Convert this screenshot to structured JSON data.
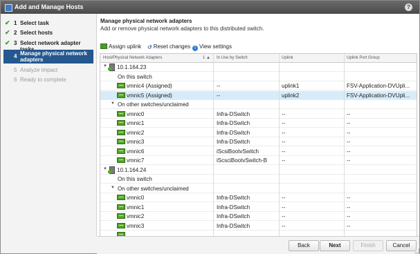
{
  "window": {
    "title": "Add and Manage Hosts",
    "help_label": "?"
  },
  "steps": [
    {
      "num": "1",
      "label": "Select task",
      "state": "done",
      "check": "✔"
    },
    {
      "num": "2",
      "label": "Select hosts",
      "state": "done",
      "check": "✔"
    },
    {
      "num": "3",
      "label": "Select network adapter tasks",
      "state": "done",
      "check": "✔"
    },
    {
      "num": "4",
      "label": "Manage physical network adapters",
      "state": "active"
    },
    {
      "num": "5",
      "label": "Analyze impact",
      "state": "pending"
    },
    {
      "num": "6",
      "label": "Ready to complete",
      "state": "pending"
    }
  ],
  "main": {
    "heading": "Manage physical network adapters",
    "subheading": "Add or remove physical network adapters to this distributed switch."
  },
  "toolbar": {
    "assign_uplink": "Assign uplink",
    "reset_changes": "Reset changes",
    "view_settings": "View settings",
    "reset_icon_glyph": "↺",
    "info_icon_glyph": "i"
  },
  "table": {
    "headers": [
      "Host/Physical Network Adapters",
      "1 ▲",
      "In Use by Switch",
      "Uplink",
      "Uplink Port Group"
    ],
    "rows": [
      {
        "type": "host",
        "name": "10.1.164.23",
        "toggle": "▼"
      },
      {
        "type": "group",
        "name": "On this switch",
        "toggle": ""
      },
      {
        "type": "nic",
        "name": "vmnic4 (Assigned)",
        "switch": "--",
        "uplink": "uplink1",
        "portgroup": "FSV-Application-DVUpli..."
      },
      {
        "type": "nic",
        "name": "vmnic5 (Assigned)",
        "switch": "--",
        "uplink": "uplink2",
        "portgroup": "FSV-Application-DVUpli...",
        "selected": true
      },
      {
        "type": "group",
        "name": "On other switches/unclaimed",
        "toggle": "▼"
      },
      {
        "type": "nic",
        "name": "vmnic0",
        "switch": "Infra-DSwitch",
        "uplink": "--",
        "portgroup": "--"
      },
      {
        "type": "nic",
        "name": "vmnic1",
        "switch": "Infra-DSwitch",
        "uplink": "--",
        "portgroup": "--"
      },
      {
        "type": "nic",
        "name": "vmnic2",
        "switch": "Infra-DSwitch",
        "uplink": "--",
        "portgroup": "--"
      },
      {
        "type": "nic",
        "name": "vmnic3",
        "switch": "Infra-DSwitch",
        "uplink": "--",
        "portgroup": "--"
      },
      {
        "type": "nic",
        "name": "vmnic6",
        "switch": "iScsiBootvSwitch",
        "uplink": "--",
        "portgroup": "--"
      },
      {
        "type": "nic",
        "name": "vmnic7",
        "switch": "iScsciBootvSwitch-B",
        "uplink": "--",
        "portgroup": "--"
      },
      {
        "type": "host",
        "name": "10.1.164.24",
        "toggle": "▼"
      },
      {
        "type": "group",
        "name": "On this switch",
        "toggle": ""
      },
      {
        "type": "group",
        "name": "On other switches/unclaimed",
        "toggle": "▼"
      },
      {
        "type": "nic",
        "name": "vmnic0",
        "switch": "Infra-DSwitch",
        "uplink": "--",
        "portgroup": "--"
      },
      {
        "type": "nic",
        "name": "vmnic1",
        "switch": "Infra-DSwitch",
        "uplink": "--",
        "portgroup": "--"
      },
      {
        "type": "nic",
        "name": "vmnic2",
        "switch": "Infra-DSwitch",
        "uplink": "--",
        "portgroup": "--"
      },
      {
        "type": "nic",
        "name": "vmnic3",
        "switch": "Infra-DSwitch",
        "uplink": "--",
        "portgroup": "--"
      },
      {
        "type": "nic",
        "name": "",
        "switch": "",
        "uplink": "",
        "portgroup": ""
      }
    ]
  },
  "buttons": {
    "back": "Back",
    "next": "Next",
    "finish": "Finish",
    "cancel": "Cancel"
  },
  "colors": {
    "accent": "#24588f",
    "selected_row": "#d7ebf9",
    "nic_icon": "#55a32a"
  }
}
